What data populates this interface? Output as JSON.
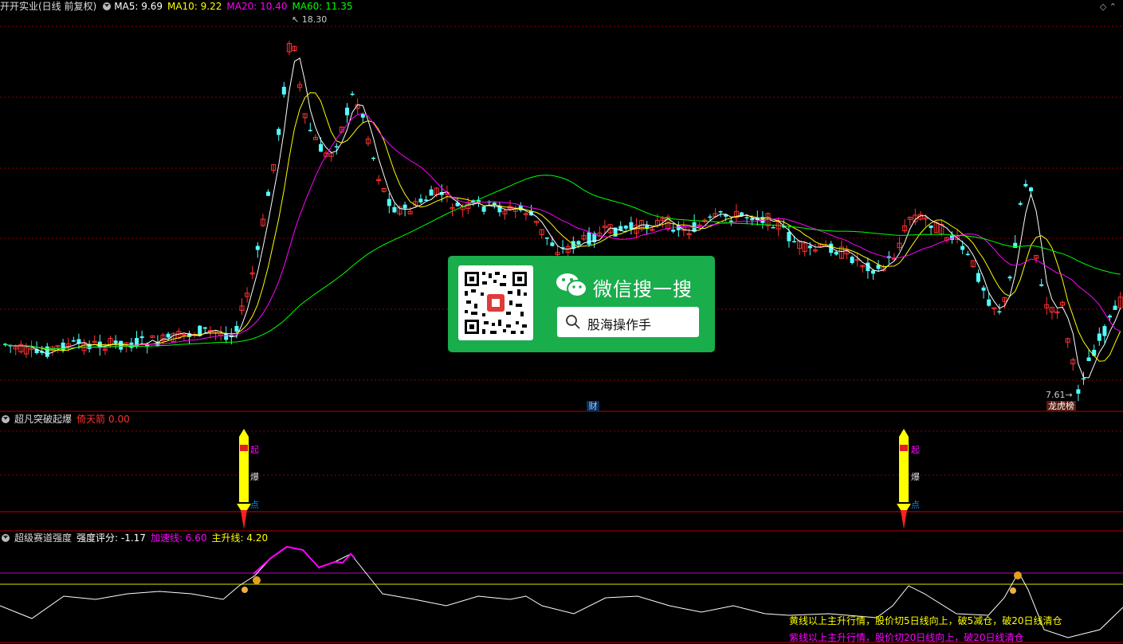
{
  "header": {
    "title": "开开实业(日线 前复权)",
    "ma": [
      {
        "label": "MA5: 9.69",
        "color": "#ffffff"
      },
      {
        "label": "MA10: 9.22",
        "color": "#ffff00"
      },
      {
        "label": "MA20: 10.40",
        "color": "#ff00ff"
      },
      {
        "label": "MA60: 11.35",
        "color": "#00ff00"
      }
    ]
  },
  "price_chart": {
    "high_label": "18.30",
    "low_label": "7.61",
    "event_marks": {
      "cai": "财",
      "bang": "龙虎榜"
    }
  },
  "panel2": {
    "name": "超凡突破起爆",
    "indicator_label": "倚天箭",
    "indicator_value": "0.00",
    "rocket_labels": [
      "起",
      "爆",
      "点"
    ]
  },
  "panel3": {
    "name": "超级赛道强度",
    "score": "强度评分: -1.17",
    "accel_line": "加速线: 6.60",
    "main_line": "主升线: 4.20",
    "rule_yellow": "黄线以上主升行情，股价切5日线向上，破5减仓，破20日线清仓",
    "rule_purple": "紫线以上主升行情，股价切20日线向上，破20日线清仓"
  },
  "wechat": {
    "title": "微信搜一搜",
    "search_text": "股海操作手"
  },
  "colors": {
    "up": "#ff3232",
    "down": "#54ffff",
    "grid": "#8b0000",
    "ma5": "#ffffff",
    "ma10": "#ffff00",
    "ma20": "#ff00ff",
    "ma60": "#00ff00",
    "wechat_green": "#1aad4b"
  }
}
